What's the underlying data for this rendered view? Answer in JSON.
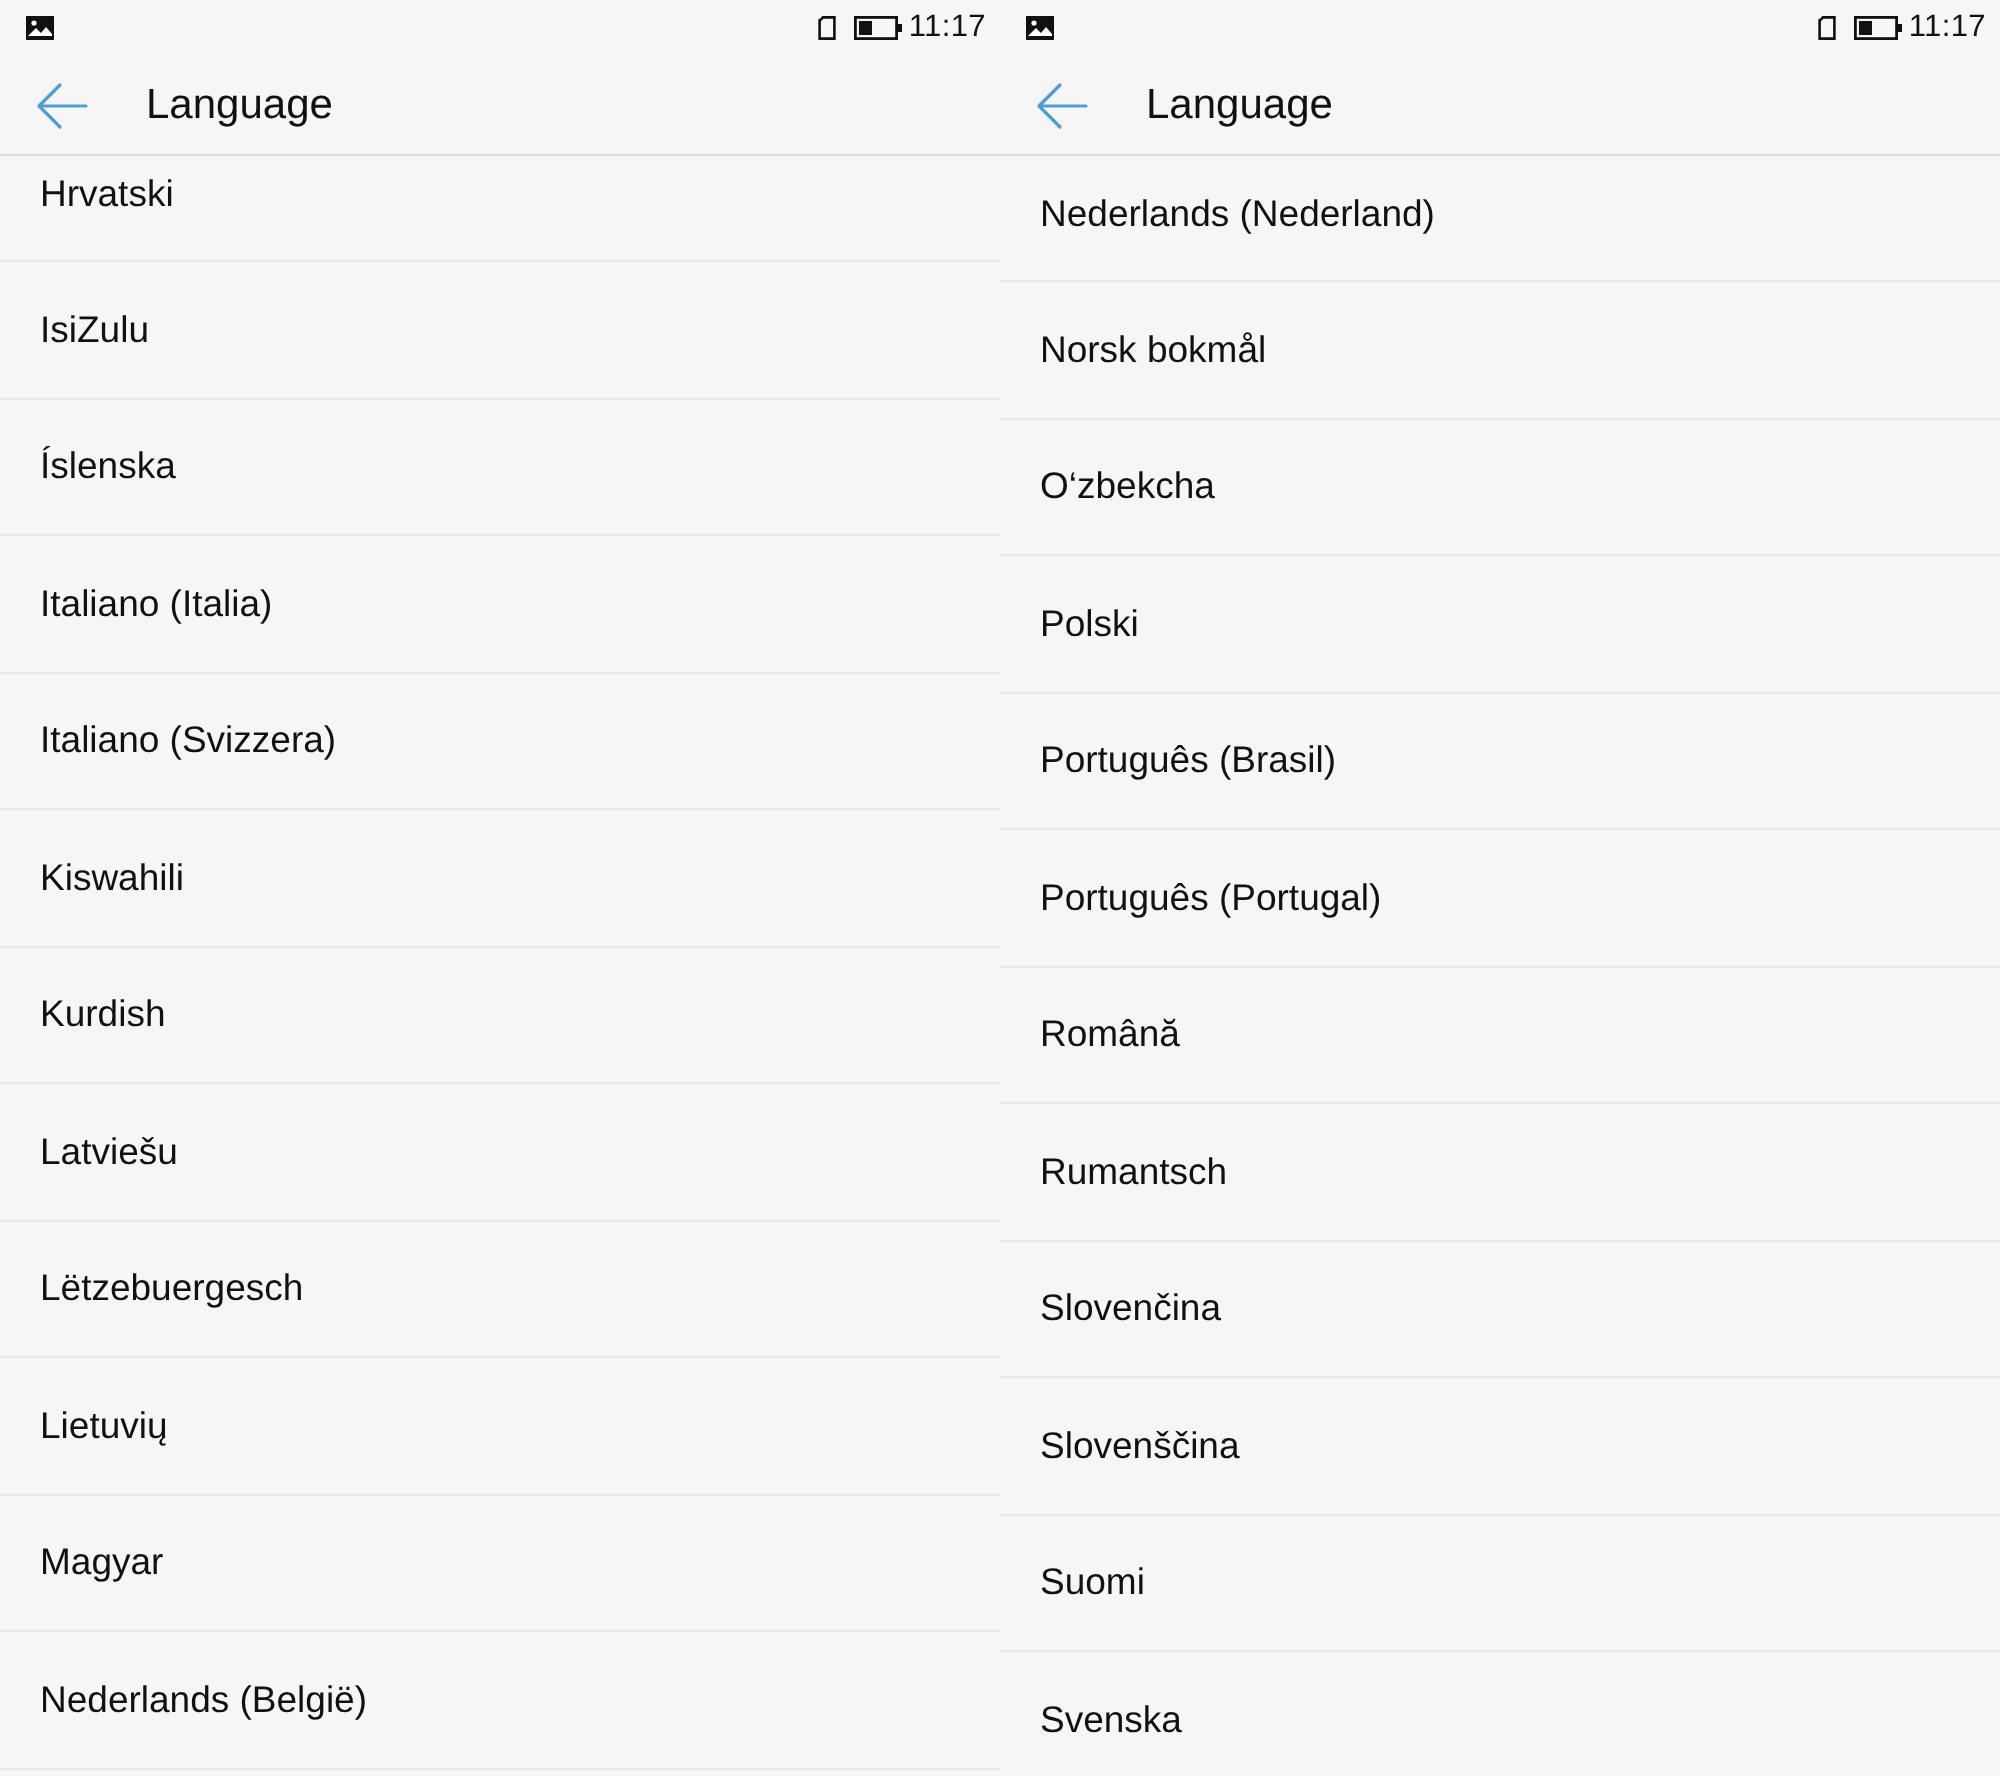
{
  "screens": [
    {
      "status_bar": {
        "time": "11:17"
      },
      "header": {
        "title": "Language"
      },
      "languages": [
        "Hrvatski",
        "IsiZulu",
        "Íslenska",
        "Italiano (Italia)",
        "Italiano (Svizzera)",
        "Kiswahili",
        "Kurdish",
        "Latviešu",
        "Lëtzebuergesch",
        "Lietuvių",
        "Magyar",
        "Nederlands (België)"
      ]
    },
    {
      "status_bar": {
        "time": "11:17"
      },
      "header": {
        "title": "Language"
      },
      "languages": [
        "Nederlands (Nederland)",
        "Norsk bokmål",
        "O‘zbekcha",
        "Polski",
        "Português (Brasil)",
        "Português (Portugal)",
        "Română",
        "Rumantsch",
        "Slovenčina",
        "Slovenščina",
        "Suomi",
        "Svenska"
      ]
    }
  ]
}
